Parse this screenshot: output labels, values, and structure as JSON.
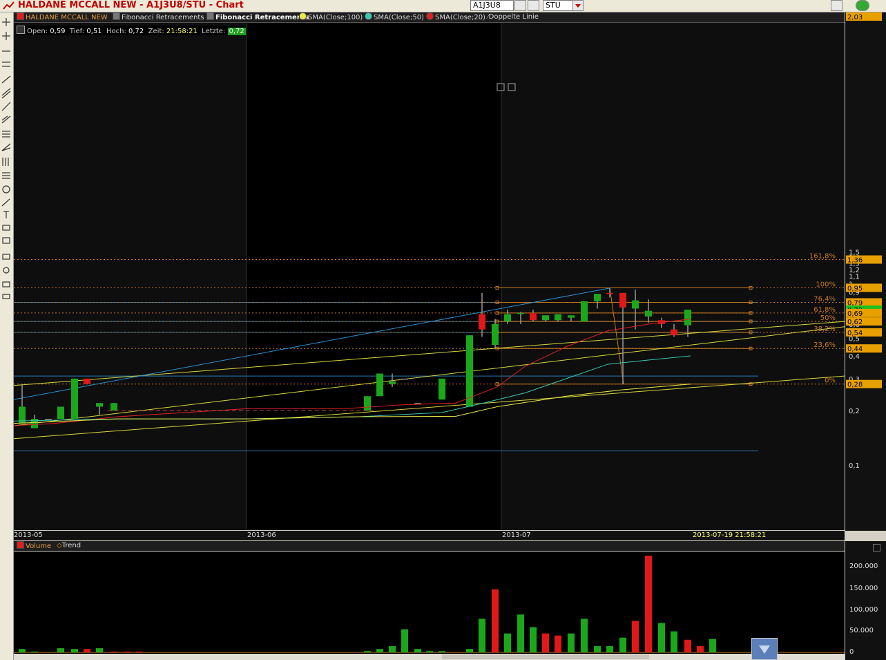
{
  "window": {
    "title": "HALDANE MCCALL NEW - A1J3U8/STU - Chart",
    "symbol": "A1J3U8",
    "exchange": "STU"
  },
  "legend": {
    "instrument": "HALDANE MCCALL NEW",
    "fib1": "Fibonacci Retracements",
    "fib2": "Fibonacci Retracements",
    "sma100": "SMA(Close;100)",
    "sma50": "SMA(Close;50)",
    "sma20": "SMA(Close;20)",
    "line": "Doppelte Linie",
    "colors": {
      "sma100": "#e8e84a",
      "sma50": "#38c8b0",
      "sma20": "#e02020",
      "trend": "#d0d040",
      "blue": "#2090d0",
      "fib": "#c87820"
    }
  },
  "ohlc": {
    "open_label": "Open:",
    "open": "0,59",
    "low_label": "Tief:",
    "low": "0,51",
    "high_label": "Hoch:",
    "high": "0,72",
    "time_label": "Zeit:",
    "time": "21:58:21",
    "last_label": "Letzte:",
    "last": "0,72"
  },
  "price_axis": {
    "ticks": [
      "1,5",
      "1,4",
      "1,3",
      "1,2",
      "1,1",
      "1",
      "0,9",
      "0,8",
      "0,7",
      "0,6",
      "0,5",
      "0,4",
      "0,3",
      "0,2",
      "0,1"
    ],
    "tags": [
      {
        "text": "2,03",
        "color": "#e8a000"
      },
      {
        "text": "1,36",
        "color": "#e8a000"
      },
      {
        "text": "0,95",
        "color": "#e8a000"
      },
      {
        "text": "0,79",
        "color": "#e8a000"
      },
      {
        "text": "0,72",
        "color": "#20c020"
      },
      {
        "text": "0,69",
        "color": "#e8a000"
      },
      {
        "text": "0,62",
        "color": "#e8a000"
      },
      {
        "text": "0,54",
        "color": "#e8a000"
      },
      {
        "text": "0,44",
        "color": "#e8a000"
      },
      {
        "text": "0,28",
        "color": "#e8a000"
      }
    ]
  },
  "fib_levels": [
    "161,8%",
    "100%",
    "76,4%",
    "61,8%",
    "50%",
    "38,2%",
    "23,6%",
    "0%"
  ],
  "date_axis": {
    "labels": [
      "2013-05",
      "2013-06",
      "2013-07"
    ],
    "cursor": "2013-07-19 21:58:21"
  },
  "volume": {
    "tab_volume": "Volume",
    "tab_trend": "Trend",
    "ticks": [
      "200.000",
      "150.000",
      "100.000",
      "50.000",
      "0"
    ]
  },
  "chart_data": {
    "type": "candlestick",
    "y_scale": "log",
    "candles": [
      {
        "o": 0.17,
        "h": 0.28,
        "l": 0.17,
        "c": 0.21,
        "color": "green"
      },
      {
        "o": 0.16,
        "h": 0.19,
        "l": 0.16,
        "c": 0.18,
        "color": "green"
      },
      {
        "o": 0.18,
        "h": 0.18,
        "l": 0.18,
        "c": 0.18,
        "color": "gray"
      },
      {
        "o": 0.18,
        "h": 0.21,
        "l": 0.18,
        "c": 0.21,
        "color": "green"
      },
      {
        "o": 0.18,
        "h": 0.3,
        "l": 0.18,
        "c": 0.3,
        "color": "green"
      },
      {
        "o": 0.3,
        "h": 0.3,
        "l": 0.28,
        "c": 0.28,
        "color": "red"
      },
      {
        "o": 0.21,
        "h": 0.22,
        "l": 0.19,
        "c": 0.22,
        "color": "green"
      },
      {
        "o": 0.2,
        "h": 0.22,
        "l": 0.2,
        "c": 0.22,
        "color": "green"
      },
      {
        "o": 0.2,
        "h": 0.24,
        "l": 0.2,
        "c": 0.24,
        "color": "green"
      },
      {
        "o": 0.24,
        "h": 0.32,
        "l": 0.24,
        "c": 0.32,
        "color": "green"
      },
      {
        "o": 0.28,
        "h": 0.32,
        "l": 0.27,
        "c": 0.29,
        "color": "green"
      },
      {
        "o": 0.3,
        "h": 0.3,
        "l": 0.3,
        "c": 0.3,
        "color": "gray"
      },
      {
        "o": 0.22,
        "h": 0.22,
        "l": 0.22,
        "c": 0.22,
        "color": "gray"
      },
      {
        "o": 0.23,
        "h": 0.3,
        "l": 0.23,
        "c": 0.3,
        "color": "green"
      },
      {
        "o": 0.21,
        "h": 0.52,
        "l": 0.21,
        "c": 0.52,
        "color": "green"
      },
      {
        "o": 0.68,
        "h": 0.89,
        "l": 0.51,
        "c": 0.56,
        "color": "red"
      },
      {
        "o": 0.46,
        "h": 0.64,
        "l": 0.44,
        "c": 0.6,
        "color": "green"
      },
      {
        "o": 0.62,
        "h": 0.72,
        "l": 0.6,
        "c": 0.68,
        "color": "green"
      },
      {
        "o": 0.69,
        "h": 0.7,
        "l": 0.6,
        "c": 0.69,
        "color": "green"
      },
      {
        "o": 0.69,
        "h": 0.72,
        "l": 0.62,
        "c": 0.63,
        "color": "red"
      },
      {
        "o": 0.63,
        "h": 0.67,
        "l": 0.62,
        "c": 0.67,
        "color": "green"
      },
      {
        "o": 0.63,
        "h": 0.68,
        "l": 0.62,
        "c": 0.68,
        "color": "green"
      },
      {
        "o": 0.65,
        "h": 0.67,
        "l": 0.62,
        "c": 0.67,
        "color": "green"
      },
      {
        "o": 0.62,
        "h": 0.8,
        "l": 0.62,
        "c": 0.8,
        "color": "green"
      },
      {
        "o": 0.8,
        "h": 0.88,
        "l": 0.73,
        "c": 0.88,
        "color": "green"
      },
      {
        "o": 0.89,
        "h": 0.95,
        "l": 0.84,
        "c": 0.89,
        "color": "red"
      },
      {
        "o": 0.89,
        "h": 0.89,
        "l": 0.28,
        "c": 0.74,
        "color": "red"
      },
      {
        "o": 0.73,
        "h": 0.93,
        "l": 0.56,
        "c": 0.81,
        "color": "green"
      },
      {
        "o": 0.71,
        "h": 0.82,
        "l": 0.61,
        "c": 0.66,
        "color": "green"
      },
      {
        "o": 0.63,
        "h": 0.65,
        "l": 0.57,
        "c": 0.6,
        "color": "red"
      },
      {
        "o": 0.56,
        "h": 0.6,
        "l": 0.51,
        "c": 0.52,
        "color": "red"
      },
      {
        "o": 0.59,
        "h": 0.72,
        "l": 0.51,
        "c": 0.72,
        "color": "green"
      }
    ],
    "volumes": [
      {
        "v": 8000,
        "color": "green"
      },
      {
        "v": 2000,
        "color": "green"
      },
      {
        "v": 0,
        "color": "green"
      },
      {
        "v": 10000,
        "color": "green"
      },
      {
        "v": 8000,
        "color": "green"
      },
      {
        "v": 8000,
        "color": "red"
      },
      {
        "v": 10000,
        "color": "green"
      },
      {
        "v": 2000,
        "color": "red"
      },
      {
        "v": 2000,
        "color": "red"
      },
      {
        "v": 2000,
        "color": "red"
      },
      {
        "v": 0,
        "color": "green"
      },
      {
        "v": 0,
        "color": "green"
      },
      {
        "v": 0,
        "color": "green"
      },
      {
        "v": 0,
        "color": "green"
      },
      {
        "v": 3000,
        "color": "green"
      },
      {
        "v": 8000,
        "color": "green"
      },
      {
        "v": 15000,
        "color": "green"
      },
      {
        "v": 55000,
        "color": "green"
      },
      {
        "v": 8000,
        "color": "green"
      },
      {
        "v": 3000,
        "color": "green"
      },
      {
        "v": 3000,
        "color": "green"
      },
      {
        "v": 8000,
        "color": "green"
      },
      {
        "v": 80000,
        "color": "green"
      },
      {
        "v": 150000,
        "color": "red"
      },
      {
        "v": 45000,
        "color": "green"
      },
      {
        "v": 90000,
        "color": "green"
      },
      {
        "v": 60000,
        "color": "green"
      },
      {
        "v": 45000,
        "color": "red"
      },
      {
        "v": 40000,
        "color": "red"
      },
      {
        "v": 45000,
        "color": "green"
      },
      {
        "v": 80000,
        "color": "green"
      },
      {
        "v": 15000,
        "color": "green"
      },
      {
        "v": 15000,
        "color": "green"
      },
      {
        "v": 35000,
        "color": "green"
      },
      {
        "v": 75000,
        "color": "red"
      },
      {
        "v": 230000,
        "color": "red"
      },
      {
        "v": 70000,
        "color": "green"
      },
      {
        "v": 50000,
        "color": "green"
      },
      {
        "v": 30000,
        "color": "red"
      },
      {
        "v": 15000,
        "color": "red"
      },
      {
        "v": 32000,
        "color": "green"
      }
    ],
    "ylim": [
      0.085,
      2.1
    ]
  }
}
